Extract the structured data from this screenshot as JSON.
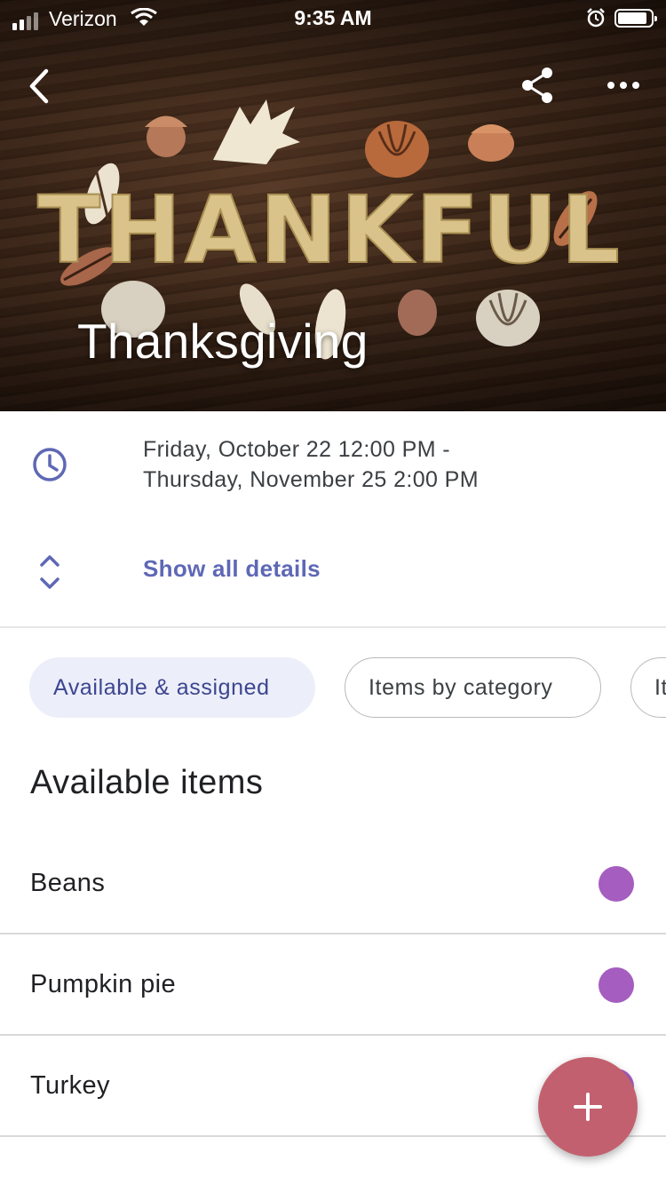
{
  "status_bar": {
    "carrier": "Verizon",
    "time": "9:35 AM",
    "icons": [
      "signal-icon",
      "wifi-icon",
      "alarm-icon",
      "battery-icon"
    ]
  },
  "header": {
    "title": "Thanksgiving",
    "cover_image_text": "THANKFUL",
    "icons": [
      "back-icon",
      "share-icon",
      "more-icon"
    ]
  },
  "event": {
    "date_start": "Friday, October 22 12:00 PM -",
    "date_end": "Thursday, November 25 2:00 PM",
    "show_details_label": "Show all details"
  },
  "filters": {
    "chips": [
      {
        "label": "Available & assigned",
        "selected": true
      },
      {
        "label": "Items by category",
        "selected": false
      },
      {
        "label": "It",
        "selected": false
      }
    ]
  },
  "section": {
    "title": "Available items"
  },
  "items": [
    {
      "name": "Beans",
      "dot_color": "#a55dbf"
    },
    {
      "name": "Pumpkin pie",
      "dot_color": "#a55dbf"
    },
    {
      "name": "Turkey",
      "dot_color": "#a55dbf"
    }
  ],
  "colors": {
    "accent": "#5e68b5",
    "chip_selected_bg": "#eceef9",
    "fab": "#c3606f",
    "item_dot": "#a55dbf"
  }
}
